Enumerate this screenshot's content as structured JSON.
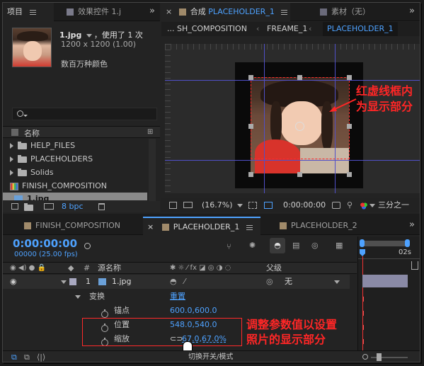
{
  "project_panel": {
    "tab_project": "项目",
    "tab_effects": "效果控件 1.j",
    "file_name": "1.jpg",
    "used_text": "，使用了 1 次",
    "dimensions": "1200 x 1200 (1.00)",
    "color_depth_text": "数百万种颜色",
    "search_placeholder": "",
    "column_name": "名称",
    "items": [
      {
        "label": "HELP_FILES",
        "type": "folder"
      },
      {
        "label": "PLACEHOLDERS",
        "type": "folder"
      },
      {
        "label": "Solids",
        "type": "folder"
      },
      {
        "label": "FINISH_COMPOSITION",
        "type": "composition"
      },
      {
        "label": "1.jpg",
        "type": "image"
      }
    ],
    "bpc": "8 bpc"
  },
  "composition_panel": {
    "tab_label": "合成",
    "tab_comp_name": "PLACEHOLDER_1",
    "tab_footage": "素材（无）",
    "breadcrumbs": [
      "... SH_COMPOSITION",
      "FREAME_1",
      "PLACEHOLDER_1"
    ],
    "zoom": "(16.7%)",
    "timecode": "0:00:00:00",
    "resolution": "三分之一",
    "annotation_top_1": "红虚线框内",
    "annotation_top_2": "为显示部分"
  },
  "timeline_panel": {
    "tabs": [
      "FINISH_COMPOSITION",
      "PLACEHOLDER_1",
      "PLACEHOLDER_2"
    ],
    "active_tab": "PLACEHOLDER_1",
    "timecode": "0:00:00:00",
    "frame_info": "00000 (25.00 fps)",
    "col_hash": "#",
    "col_source": "源名称",
    "col_parent": "父级",
    "layer_index": "1",
    "layer_name": "1.jpg",
    "parent_value": "无",
    "transform_label": "变换",
    "reset_label": "重置",
    "properties": [
      {
        "label": "锚点",
        "value": "600.0,600.0"
      },
      {
        "label": "位置",
        "value": "548.0,540.0"
      },
      {
        "label": "缩放",
        "value": "67.0,67.0%"
      }
    ],
    "toggle_label": "切换开关/模式",
    "ruler_end": "02s",
    "annotation_1": "调整参数值以设置",
    "annotation_2": "照片的显示部分"
  },
  "colors": {
    "accent_blue": "#4ea2ff",
    "annotation_red": "#ff2626",
    "guide_purple": "#5050c8",
    "playhead_red": "#e33"
  }
}
